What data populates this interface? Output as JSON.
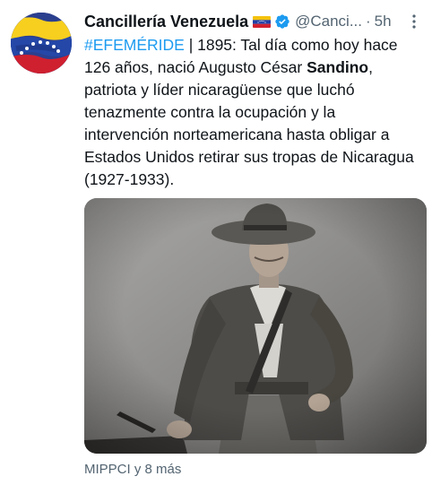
{
  "account": {
    "display_name": "Cancillería Venezuela",
    "handle": "@Canci...",
    "separator": "·",
    "time": "5h"
  },
  "tweet": {
    "hashtag": "#EFEMÉRIDE",
    "text_part1": " | 1895: Tal día como hoy hace 126 años, nació Augusto César ",
    "bold_name": "Sandino",
    "text_part2": ", patriota y líder nicaragüense que luchó tenazmente contra la ocupación y la intervención norteamericana hasta obligar a Estados Unidos retirar sus tropas de Nicaragua (1927-1933)."
  },
  "footer": {
    "liked_by": "MIPPCI y 8 más"
  },
  "colors": {
    "link": "#1d9bf0",
    "secondary_text": "#536471",
    "verified": "#1d9bf0"
  },
  "icons": [
    "venezuela-flag-icon",
    "verified-icon",
    "more-options-icon"
  ]
}
